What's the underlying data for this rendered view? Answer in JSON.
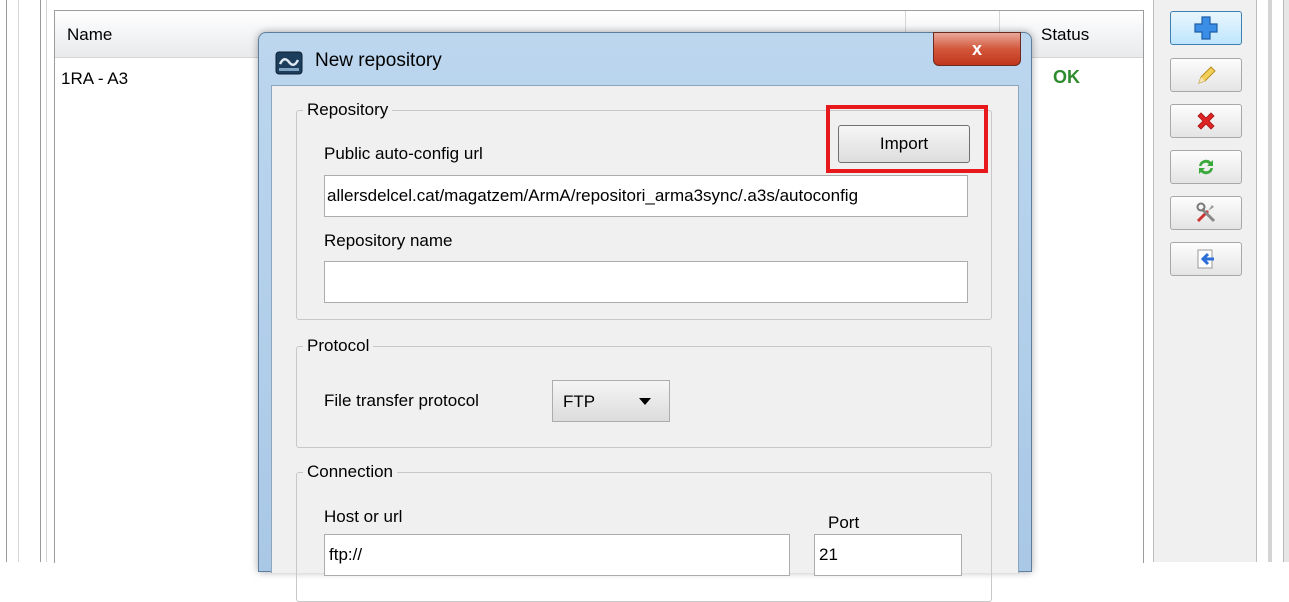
{
  "table": {
    "columns": [
      {
        "label": "Name"
      },
      {
        "label": "Status"
      }
    ],
    "rows": [
      {
        "name": "1RA - A3",
        "status": "OK"
      }
    ]
  },
  "toolbar": {
    "buttons": [
      {
        "icon": "add-icon"
      },
      {
        "icon": "edit-icon"
      },
      {
        "icon": "delete-icon"
      },
      {
        "icon": "sync-icon"
      },
      {
        "icon": "tools-icon"
      },
      {
        "icon": "export-icon"
      }
    ]
  },
  "dialog": {
    "title": "New repository",
    "close_label": "x",
    "repository": {
      "legend": "Repository",
      "import_label": "Import",
      "autoconfig_label": "Public auto-config url",
      "autoconfig_value": "allersdelcel.cat/magatzem/ArmA/repositori_arma3sync/.a3s/autoconfig",
      "name_label": "Repository name",
      "name_value": ""
    },
    "protocol": {
      "legend": "Protocol",
      "label": "File transfer protocol",
      "selected": "FTP"
    },
    "connection": {
      "legend": "Connection",
      "host_label": "Host or url",
      "host_value": "ftp://",
      "port_label": "Port",
      "port_value": "21"
    }
  },
  "colors": {
    "status_ok": "#2e8b2e",
    "highlight": "#e8191c",
    "close_button": "#c9432a"
  }
}
